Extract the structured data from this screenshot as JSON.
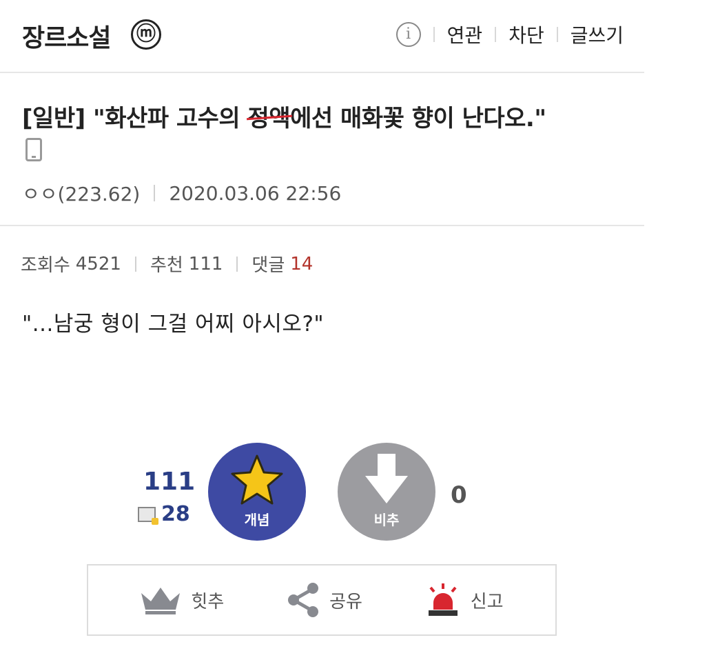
{
  "header": {
    "gallery_name": "장르소설",
    "minor_badge": "ⓜ",
    "info_icon": "ⓘ",
    "links": [
      "연관",
      "차단",
      "글쓰기"
    ]
  },
  "post": {
    "title_prefix": "[일반] \"화산파 고수의 ",
    "title_struck": "정액",
    "title_suffix": "에선 매화꽃 향이 난다오.\"",
    "device_icon": "mobile-icon",
    "author": "ㅇㅇ(223.62)",
    "datetime": "2020.03.06 22:56"
  },
  "stats": {
    "views_label": "조회수",
    "views_value": "4521",
    "recommend_label": "추천",
    "recommend_value": "111",
    "comments_label": "댓글",
    "comments_value": "14"
  },
  "body": {
    "text": "\"...남궁 형이 그걸 어찌 아시오?\""
  },
  "vote": {
    "recommend_count": "111",
    "fixed_count": "28",
    "upvote_label": "개념",
    "downvote_label": "비추",
    "downvote_count": "0",
    "colors": {
      "upvote": "#3e4aa3",
      "downvote": "#9c9ca0",
      "star": "#f5c518"
    }
  },
  "actions": {
    "hit_label": "힛추",
    "share_label": "공유",
    "report_label": "신고"
  }
}
